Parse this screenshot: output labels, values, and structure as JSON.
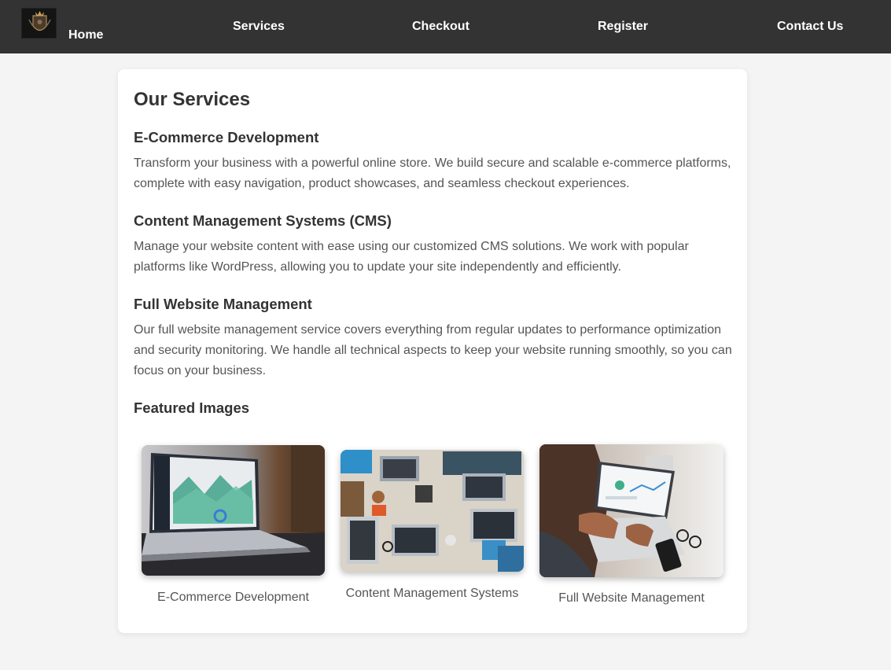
{
  "nav": {
    "home": "Home",
    "services": "Services",
    "checkout": "Checkout",
    "register": "Register",
    "contact": "Contact Us"
  },
  "main": {
    "title": "Our Services",
    "services": [
      {
        "title": "E-Commerce Development",
        "description": "Transform your business with a powerful online store. We build secure and scalable e-commerce platforms, complete with easy navigation, product showcases, and seamless checkout experiences."
      },
      {
        "title": "Content Management Systems (CMS)",
        "description": "Manage your website content with ease using our customized CMS solutions. We work with popular platforms like WordPress, allowing you to update your site independently and efficiently."
      },
      {
        "title": "Full Website Management",
        "description": "Our full website management service covers everything from regular updates to performance optimization and security monitoring. We handle all technical aspects to keep your website running smoothly, so you can focus on your business."
      }
    ],
    "featured_title": "Featured Images",
    "featured": [
      {
        "caption": "E-Commerce Development"
      },
      {
        "caption": "Content Management Systems"
      },
      {
        "caption": "Full Website Management"
      }
    ]
  },
  "colors": {
    "navbar": "#333333",
    "page_bg": "#f4f4f4",
    "card_bg": "#ffffff",
    "heading": "#333333",
    "body_text": "#555555"
  }
}
